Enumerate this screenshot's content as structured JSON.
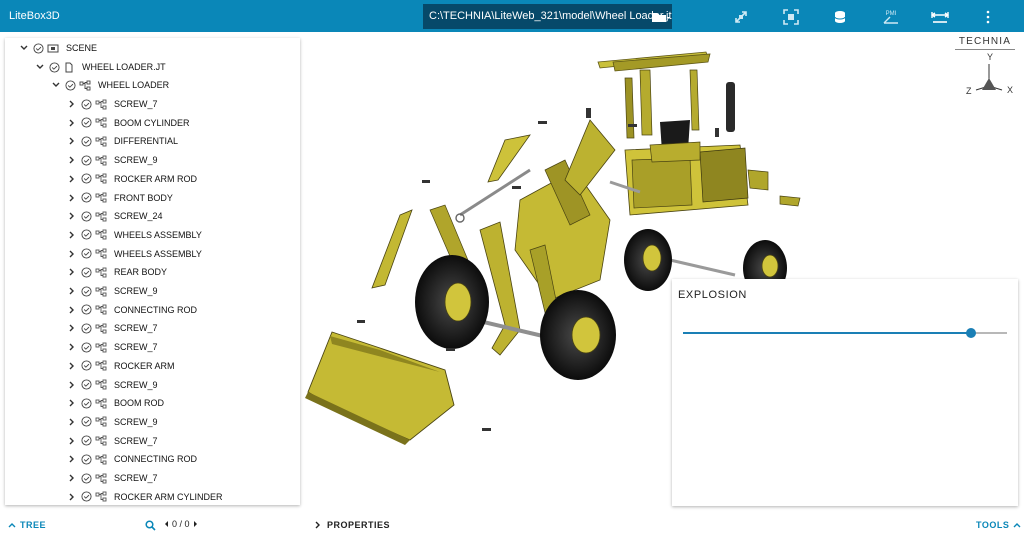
{
  "app": {
    "title": "LiteBox3D"
  },
  "toolbar": {
    "file_path": "C:\\TECHNIA\\LiteWeb_321\\model\\Wheel Loader.jt",
    "icons": [
      "folder-icon",
      "explode-icon",
      "fit-view-icon",
      "material-icon",
      "pmi-icon",
      "measure-icon",
      "more-vert-icon"
    ],
    "pmi_label": "PMI",
    "accent": "#0a87b8"
  },
  "tree": {
    "root": {
      "label": "SCENE"
    },
    "file": {
      "label": "WHEEL LOADER.JT"
    },
    "assembly": {
      "label": "WHEEL LOADER"
    },
    "items": [
      "SCREW_7",
      "BOOM CYLINDER",
      "DIFFERENTIAL",
      "SCREW_9",
      "ROCKER ARM ROD",
      "FRONT BODY",
      "SCREW_24",
      "WHEELS ASSEMBLY",
      "WHEELS ASSEMBLY",
      "REAR BODY",
      "SCREW_9",
      "CONNECTING ROD",
      "SCREW_7",
      "SCREW_7",
      "ROCKER ARM",
      "SCREW_9",
      "BOOM ROD",
      "SCREW_9",
      "SCREW_7",
      "CONNECTING ROD",
      "SCREW_7",
      "ROCKER ARM CYLINDER"
    ]
  },
  "explosion": {
    "title": "EXPLOSION",
    "value": 0.89
  },
  "logo": {
    "text": "TECHNIA"
  },
  "axis": {
    "x": "X",
    "y": "Y",
    "z": "Z"
  },
  "bottom": {
    "tree_label": "TREE",
    "search_counter": "0 / 0",
    "properties_label": "PROPERTIES",
    "tools_label": "TOOLS"
  }
}
